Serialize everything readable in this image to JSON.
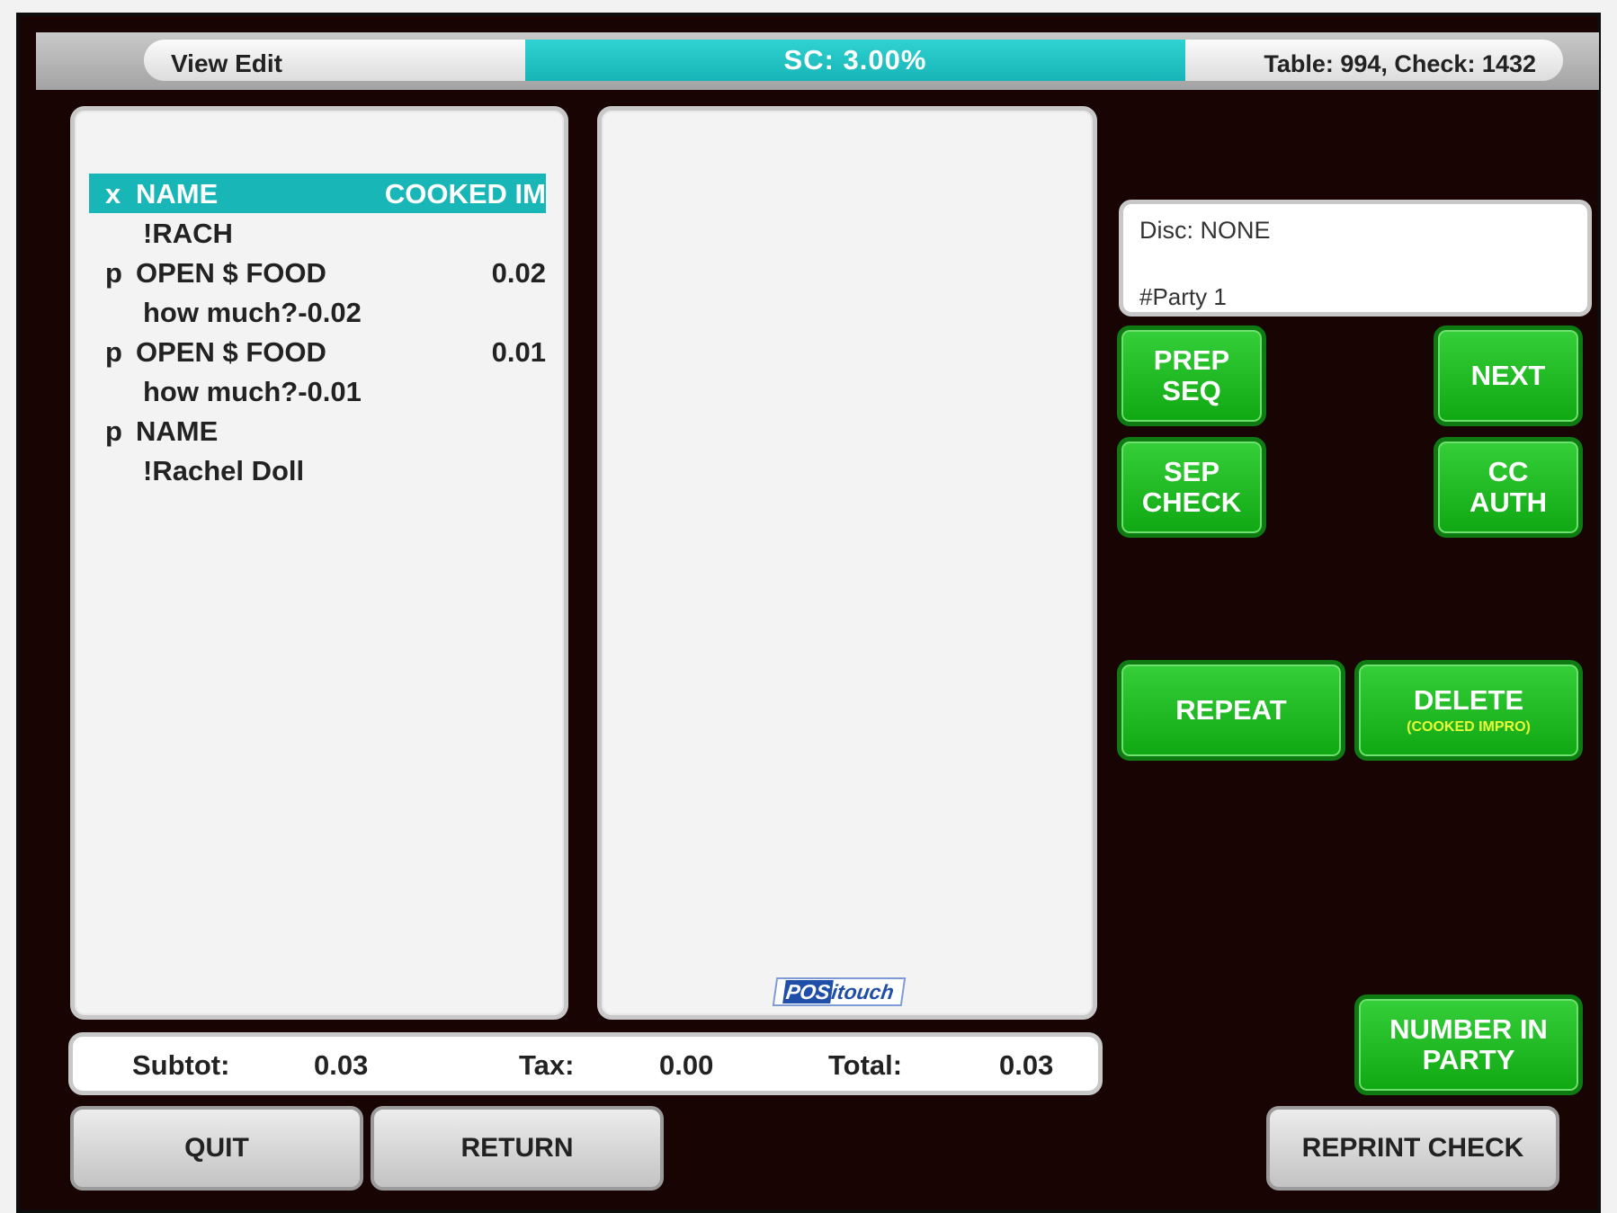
{
  "header": {
    "mode": "View Edit",
    "service_charge": "SC:  3.00%",
    "table_check": "Table: 994, Check: 1432"
  },
  "check_items": [
    {
      "flag": "x",
      "name": "NAME",
      "value": "COOKED IM",
      "selected": true,
      "sub": false
    },
    {
      "flag": "",
      "name": "!RACH",
      "value": "",
      "selected": false,
      "sub": true
    },
    {
      "flag": "p",
      "name": "OPEN $ FOOD",
      "value": "0.02",
      "selected": false,
      "sub": false
    },
    {
      "flag": "",
      "name": "how much?-0.02",
      "value": "",
      "selected": false,
      "sub": true
    },
    {
      "flag": "p",
      "name": "OPEN $ FOOD",
      "value": "0.01",
      "selected": false,
      "sub": false
    },
    {
      "flag": "",
      "name": "how much?-0.01",
      "value": "",
      "selected": false,
      "sub": true
    },
    {
      "flag": "p",
      "name": "NAME",
      "value": "",
      "selected": false,
      "sub": false
    },
    {
      "flag": "",
      "name": "!Rachel Doll",
      "value": "",
      "selected": false,
      "sub": true
    }
  ],
  "logo": {
    "pos": "POS",
    "rest": "itouch"
  },
  "info": {
    "disc": "Disc: NONE",
    "party": "#Party  1"
  },
  "buttons": {
    "prep_seq": [
      "PREP",
      "SEQ"
    ],
    "next": "NEXT",
    "sep_check": [
      "SEP",
      "CHECK"
    ],
    "cc_auth": [
      "CC",
      "AUTH"
    ],
    "repeat": "REPEAT",
    "delete": "DELETE",
    "delete_sub": "(COOKED IMPRO)",
    "number_in_party": [
      "NUMBER IN",
      "PARTY"
    ],
    "quit": "QUIT",
    "return": "RETURN",
    "reprint_check": "REPRINT CHECK"
  },
  "totals": {
    "subtot_label": "Subtot:",
    "subtot": "0.03",
    "tax_label": "Tax:",
    "tax": "0.00",
    "total_label": "Total:",
    "total": "0.03"
  },
  "colors": {
    "accent": "#19b6b8",
    "button_green": "#1fbf24",
    "background": "#190404"
  }
}
